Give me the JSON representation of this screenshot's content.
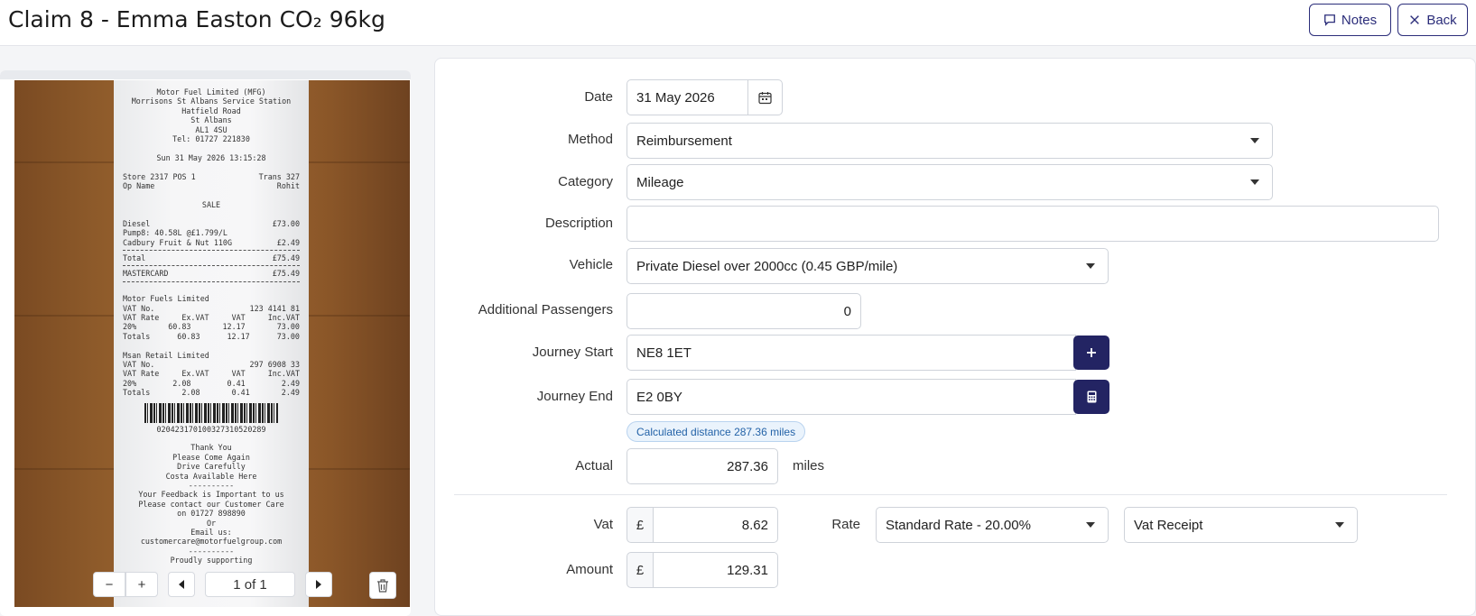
{
  "header": {
    "title": "Claim 8 - Emma Easton CO₂ 96kg",
    "notes_label": "Notes",
    "back_label": "Back"
  },
  "viewer": {
    "page_indicator": "1 of 1",
    "zoom_out": "−",
    "zoom_in": "+"
  },
  "receipt": {
    "lines_top": [
      "Motor Fuel Limited (MFG)",
      "Morrisons St Albans Service Station",
      "Hatfield Road",
      "St Albans",
      "AL1 4SU",
      "Tel: 01727 221830",
      "",
      "Sun 31 May 2026 13:15:28"
    ],
    "store": [
      "Store 2317 POS 1",
      "Trans 327"
    ],
    "op": [
      "Op Name",
      "Rohit"
    ],
    "sale": "SALE",
    "diesel": [
      "Diesel",
      "£73.00"
    ],
    "pump": "Pump8: 40.58L @£1.799/L",
    "cadbury": [
      "Cadbury Fruit & Nut 110G",
      "£2.49"
    ],
    "total": [
      "Total",
      "£75.49"
    ],
    "mastercard": [
      "MASTERCARD",
      "£75.49"
    ],
    "mfl": "Motor Fuels Limited",
    "mfl_vat": [
      "VAT No.",
      "123 4141 81"
    ],
    "mfl_head": [
      "VAT Rate",
      "Ex.VAT",
      "VAT",
      "Inc.VAT"
    ],
    "mfl_row": [
      "20%",
      "60.83",
      "12.17",
      "73.00"
    ],
    "mfl_tot": [
      "Totals",
      "60.83",
      "12.17",
      "73.00"
    ],
    "msan": "Msan Retail Limited",
    "msan_vat": [
      "VAT No.",
      "297 6908 33"
    ],
    "msan_head": [
      "VAT Rate",
      "Ex.VAT",
      "VAT",
      "Inc.VAT"
    ],
    "msan_row": [
      "20%",
      "2.08",
      "0.41",
      "2.49"
    ],
    "msan_tot": [
      "Totals",
      "2.08",
      "0.41",
      "2.49"
    ],
    "barcode_num": "02042317010032731052028​9",
    "lines_bottom": [
      "Thank You",
      "Please Come Again",
      "Drive Carefully",
      "Costa Available Here",
      "----------",
      "Your Feedback is Important to us",
      "Please contact our Customer Care",
      "on 01727 898890",
      "Or",
      "Email us: customercare@motorfuelgroup.com",
      "----------",
      "Proudly supporting"
    ]
  },
  "form": {
    "date": {
      "label": "Date",
      "value": "31 May 2026"
    },
    "method": {
      "label": "Method",
      "value": "Reimbursement"
    },
    "category": {
      "label": "Category",
      "value": "Mileage"
    },
    "description": {
      "label": "Description",
      "value": ""
    },
    "vehicle": {
      "label": "Vehicle",
      "value": "Private Diesel over 2000cc (0.45 GBP/mile)"
    },
    "passengers": {
      "label": "Additional Passengers",
      "value": "0"
    },
    "journey_start": {
      "label": "Journey Start",
      "value": "NE8 1ET"
    },
    "journey_end": {
      "label": "Journey End",
      "value": "E2 0BY"
    },
    "calculated": "Calculated distance 287.36 miles",
    "actual": {
      "label": "Actual",
      "value": "287.36",
      "unit": "miles"
    },
    "vat": {
      "label": "Vat",
      "currency": "£",
      "value": "8.62"
    },
    "rate": {
      "label": "Rate",
      "value": "Standard Rate - 20.00%"
    },
    "vat_type": {
      "value": "Vat Receipt"
    },
    "amount": {
      "label": "Amount",
      "currency": "£",
      "value": "129.31"
    }
  },
  "colors": {
    "primary": "#232463",
    "badge_text": "#2463a8",
    "badge_bg": "#eaf3fc"
  }
}
